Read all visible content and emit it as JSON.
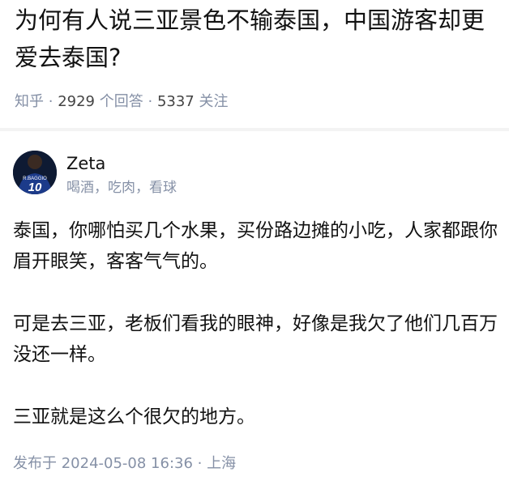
{
  "question": {
    "title": "为何有人说三亚景色不输泰国，中国游客却更爱去泰国?",
    "source": "知乎",
    "answer_count": "2929",
    "answer_label": "个回答",
    "follow_count": "5337",
    "follow_label": "关注",
    "separator": "·"
  },
  "answer": {
    "author": {
      "name": "Zeta",
      "bio": "喝酒，吃肉，看球",
      "avatar_text": "R.BAGGIO",
      "avatar_number": "10"
    },
    "paragraphs": [
      "泰国，你哪怕买几个水果，买份路边摊的小吃，人家都跟你眉开眼笑，客客气气的。",
      "可是去三亚，老板们看我的眼神，好像是我欠了他们几百万没还一样。",
      "三亚就是这么个很欠的地方。"
    ],
    "published": "发布于 2024-05-08 16:36",
    "location_separator": "·",
    "location": "上海"
  },
  "colors": {
    "text": "#121212",
    "muted": "#8590a6",
    "divider": "#f3f3f3"
  }
}
